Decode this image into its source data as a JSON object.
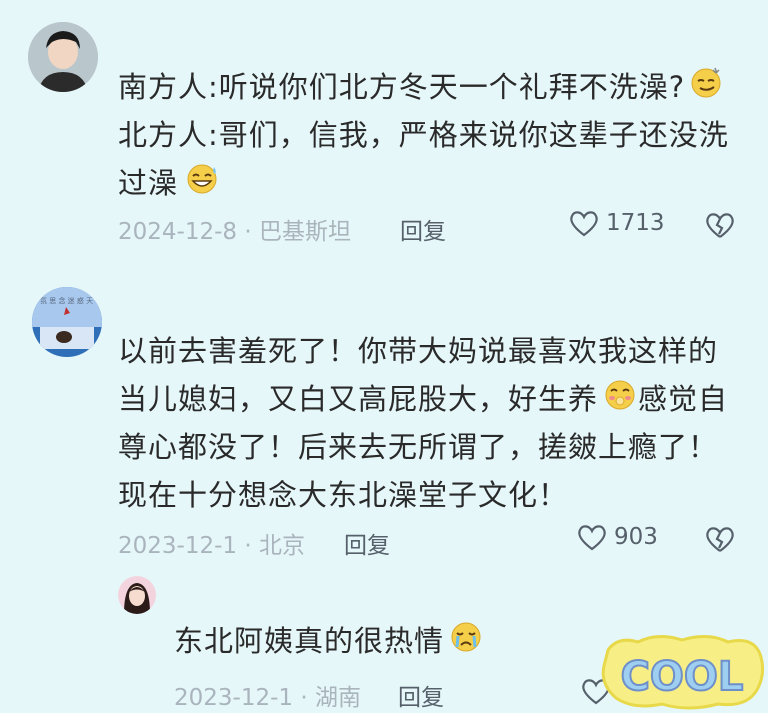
{
  "comments": [
    {
      "lines": [
        "南方人:听说你们北方冬天一个礼拜不洗澡?",
        "北方人:哥们，信我，严格来说你这辈子还没洗",
        "过澡"
      ],
      "meta": "2024-12-8 · 巴基斯坦",
      "reply": "回复",
      "likes": "1713",
      "emojis": [
        "smirk-emoji",
        "grin-sweat-emoji"
      ]
    },
    {
      "lines": [
        "以前去害羞死了！你带大妈说最喜欢我这样的",
        "当儿媳妇，又白又高屁股大，好生养",
        "感觉自",
        "尊心都没了！后来去无所谓了，搓皴上瘾了！",
        "现在十分想念大东北澡堂子文化！"
      ],
      "meta": "2023-12-1 · 北京",
      "reply": "回复",
      "likes": "903",
      "emojis": [
        "shy-emoji"
      ]
    },
    {
      "lines": [
        "东北阿姨真的很热情"
      ],
      "meta": "2023-12-1 · 湖南",
      "reply": "回复",
      "emojis": [
        "crying-emoji"
      ]
    }
  ],
  "sticker": {
    "text": "COOL"
  }
}
